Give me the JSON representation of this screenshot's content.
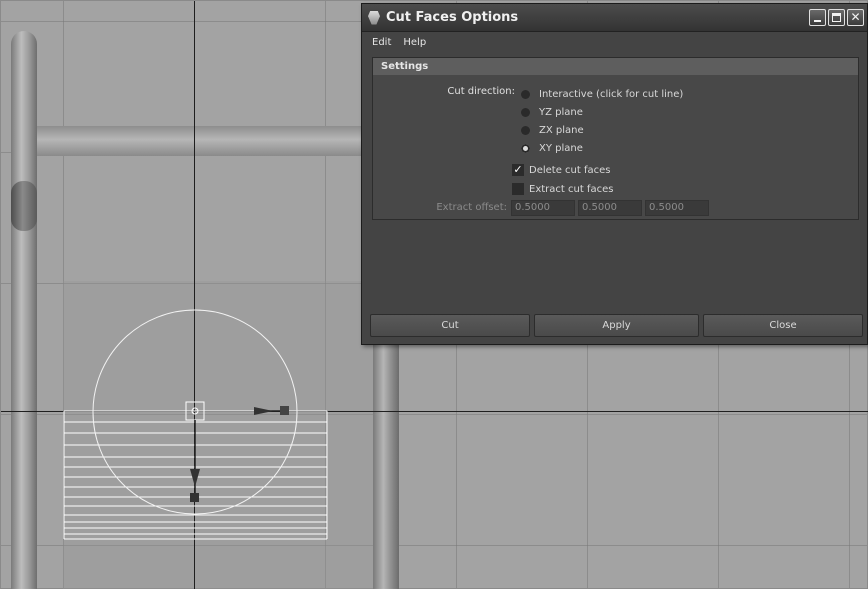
{
  "dialog": {
    "title": "Cut Faces Options",
    "window_buttons": [
      "minimize-icon",
      "maximize-icon",
      "close-icon"
    ],
    "menu": [
      "Edit",
      "Help"
    ],
    "settings": {
      "header": "Settings",
      "cut_direction_label": "Cut direction:",
      "options": [
        {
          "label": "Interactive (click for cut line)",
          "selected": false
        },
        {
          "label": "YZ plane",
          "selected": false
        },
        {
          "label": "ZX plane",
          "selected": false
        },
        {
          "label": "XY plane",
          "selected": true
        }
      ],
      "delete_cut_faces": {
        "label": "Delete cut faces",
        "checked": true
      },
      "extract_cut_faces": {
        "label": "Extract cut faces",
        "checked": false
      },
      "extract_offset_label": "Extract offset:",
      "extract_offset_values": [
        "0.5000",
        "0.5000",
        "0.5000"
      ]
    },
    "buttons": {
      "cut": "Cut",
      "apply": "Apply",
      "close": "Close"
    }
  },
  "colors": {
    "dialog_bg": "#444444",
    "viewport_bg": "#a3a3a3",
    "manipulator": "#ffffff"
  }
}
